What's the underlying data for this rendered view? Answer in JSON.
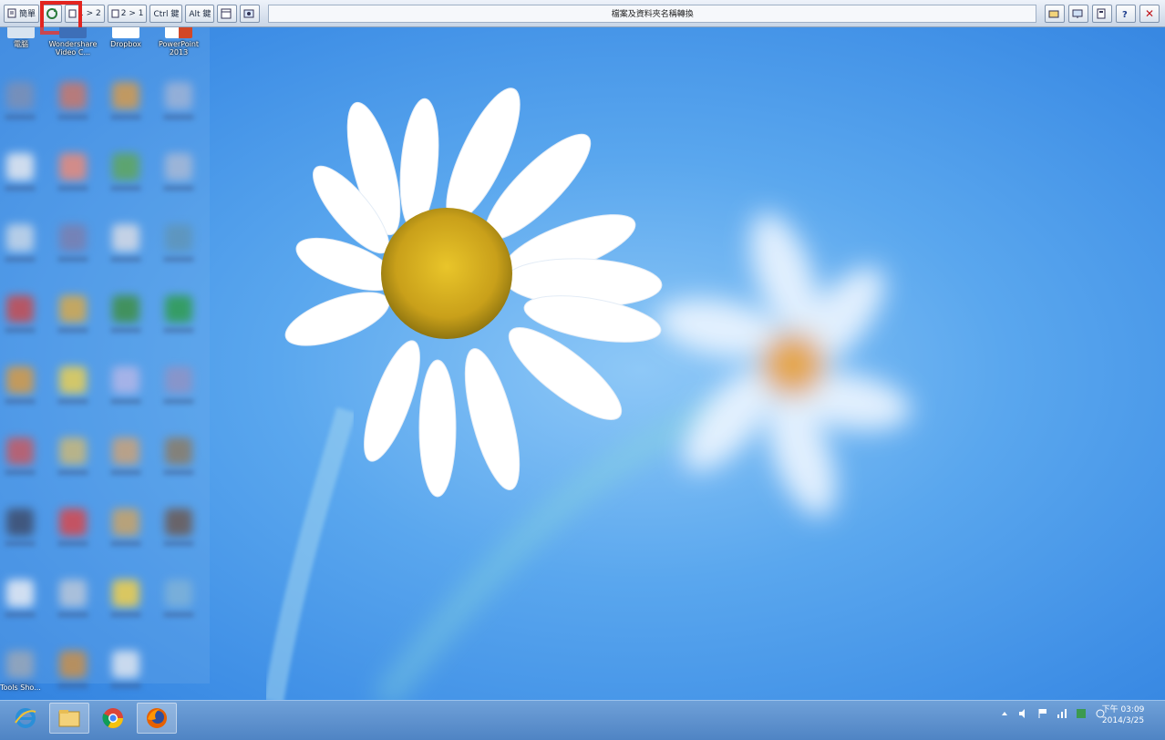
{
  "toolbar": {
    "buttons": [
      {
        "name": "toolbar-button-1",
        "label": "簡單"
      },
      {
        "name": "toolbar-button-2",
        "label": ""
      },
      {
        "name": "toolbar-button-3",
        "label": "1 > 2"
      },
      {
        "name": "toolbar-button-4",
        "label": "2 > 1"
      },
      {
        "name": "toolbar-button-5",
        "label": "Ctrl 鍵"
      },
      {
        "name": "toolbar-button-6",
        "label": "Alt 鍵"
      },
      {
        "name": "toolbar-button-7",
        "label": ""
      },
      {
        "name": "toolbar-button-8",
        "label": ""
      }
    ],
    "title": "檔案及資料夾名稱轉換",
    "close_label": "✕"
  },
  "desktop": {
    "icons": [
      {
        "label": "電腦"
      },
      {
        "label": "Wondershare Video C..."
      },
      {
        "label": "Dropbox"
      },
      {
        "label": "PowerPoint 2013"
      }
    ],
    "bottom_label": "Tools Sho..."
  },
  "clock": {
    "time": "下午 03:09",
    "date": "2014/3/25"
  },
  "colors": {
    "highlight": "#e3241f",
    "taskbar": "#5a8fce",
    "sky": "#4f9cec"
  }
}
